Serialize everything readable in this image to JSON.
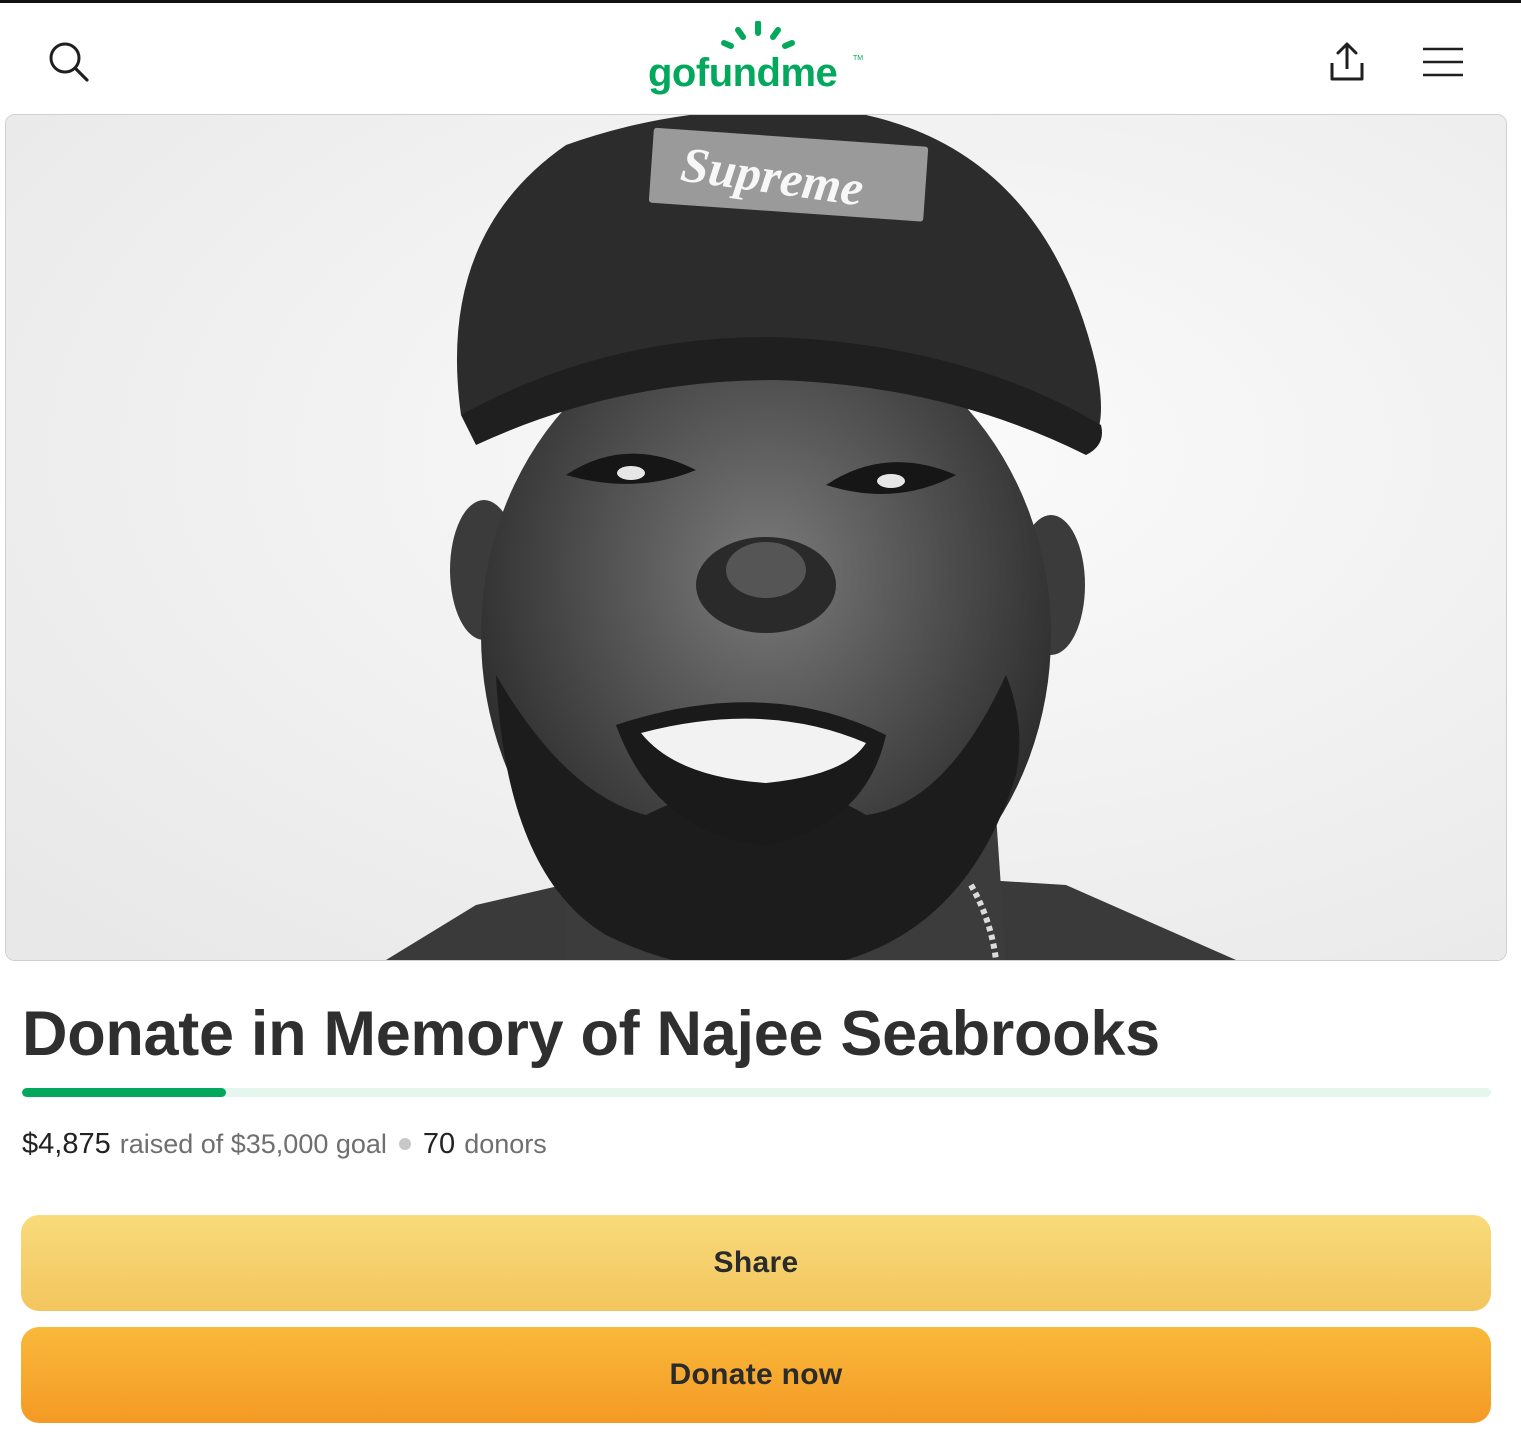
{
  "header": {
    "logo_text": "gofundme",
    "logo_tm": "TM",
    "icons": {
      "search": "search-icon",
      "share": "share-upload-icon",
      "menu": "hamburger-menu-icon"
    },
    "brand_color": "#02a95c"
  },
  "hero": {
    "cap_text": "Supreme"
  },
  "campaign": {
    "title": "Donate in Memory of Najee Seabrooks",
    "progress_fraction": 0.139,
    "raised_amount": "$4,875",
    "raised_label": "raised of $35,000 goal",
    "donor_count": "70",
    "donor_label": "donors"
  },
  "actions": {
    "share_label": "Share",
    "donate_label": "Donate now",
    "share_color": "#f6d06c",
    "donate_color": "#f7aa2e"
  }
}
